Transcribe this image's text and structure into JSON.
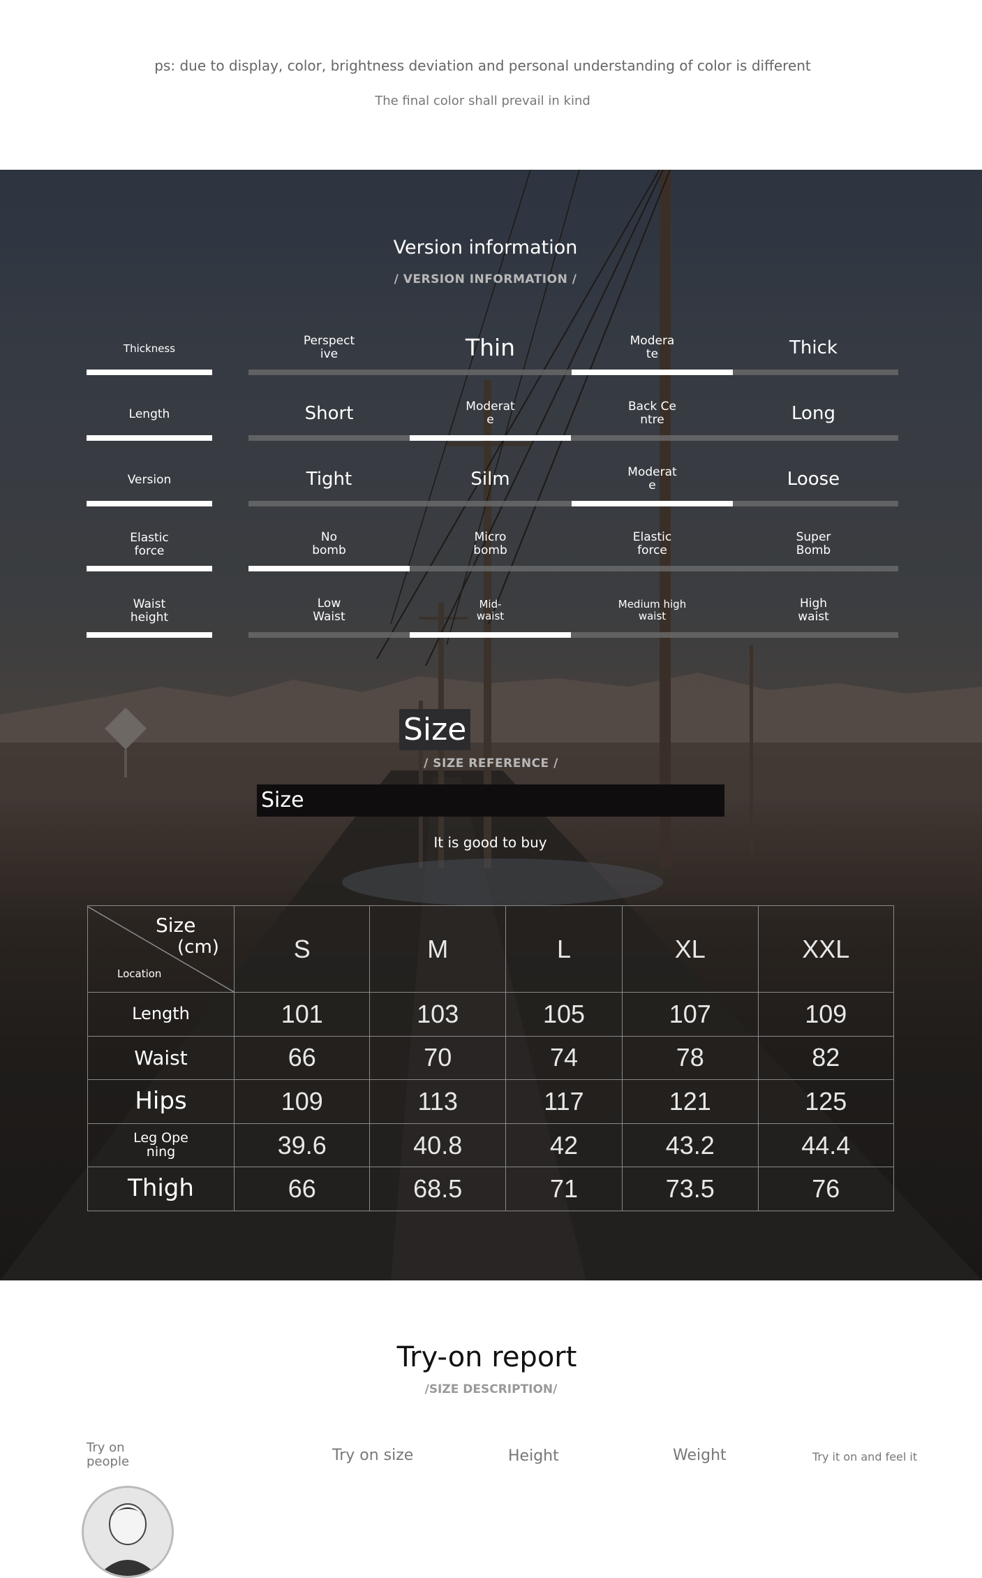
{
  "notice": {
    "line1": "ps: due to display, color, brightness deviation and personal understanding of color is different",
    "line2": "The final color shall prevail in kind"
  },
  "version": {
    "title": "Version information",
    "subtitle": "/ VERSION INFORMATION /",
    "rows": [
      {
        "label": "Thickness",
        "options": [
          "Perspect\nive",
          "Thin",
          "Modera\nte",
          "Thick"
        ],
        "selected_index": 2
      },
      {
        "label": "Length",
        "options": [
          "Short",
          "Moderat\ne",
          "Back Ce\nntre",
          "Long"
        ],
        "selected_index": 1
      },
      {
        "label": "Version",
        "options": [
          "Tight",
          "Silm",
          "Moderat\ne",
          "Loose"
        ],
        "selected_index": 2
      },
      {
        "label": "Elastic\nforce",
        "options": [
          "No\nbomb",
          "Micro\nbomb",
          "Elastic\nforce",
          "Super\nBomb"
        ],
        "selected_index": 0
      },
      {
        "label": "Waist\nheight",
        "options": [
          "Low\nWaist",
          "Mid-\nwaist",
          "Medium high\nwaist",
          "High\nwaist"
        ],
        "selected_index": 1
      }
    ]
  },
  "size": {
    "title": "Size",
    "subtitle": "/ SIZE REFERENCE /",
    "bar_label": "Size",
    "tagline": "It is good to buy",
    "corner": {
      "size": "Size",
      "unit": "(cm)",
      "location": "Location"
    },
    "columns": [
      "S",
      "M",
      "L",
      "XL",
      "XXL"
    ],
    "rows": [
      {
        "label": "Length",
        "values": [
          "101",
          "103",
          "105",
          "107",
          "109"
        ]
      },
      {
        "label": "Waist",
        "values": [
          "66",
          "70",
          "74",
          "78",
          "82"
        ]
      },
      {
        "label": "Hips",
        "values": [
          "109",
          "113",
          "117",
          "121",
          "125"
        ]
      },
      {
        "label": "Leg Ope\nning",
        "values": [
          "39.6",
          "40.8",
          "42",
          "43.2",
          "44.4"
        ]
      },
      {
        "label": "Thigh",
        "values": [
          "66",
          "68.5",
          "71",
          "73.5",
          "76"
        ]
      }
    ]
  },
  "tryon": {
    "title": "Try-on report",
    "subtitle": "/SIZE DESCRIPTION/",
    "columns": [
      "Try on\npeople",
      "Try on size",
      "Height",
      "Weight",
      "Try it on and feel it"
    ]
  },
  "colors": {
    "bar_on": "#ffffff",
    "bar_off": "#6b6b6b",
    "table_line": "#8a8a8a"
  }
}
